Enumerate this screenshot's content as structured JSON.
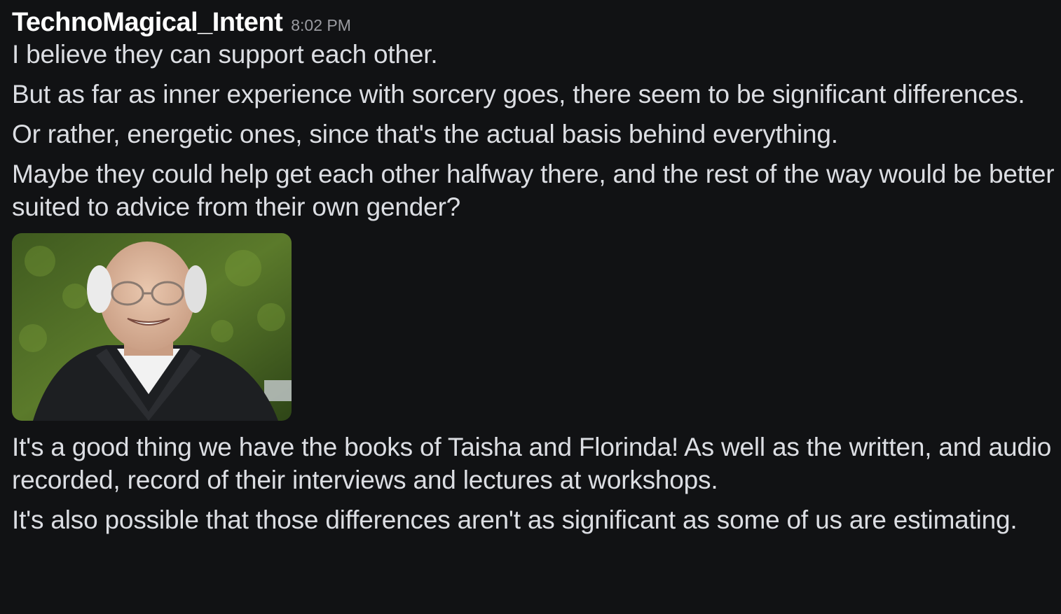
{
  "message": {
    "author": "TechnoMagical_Intent",
    "time": "8:02 PM",
    "lines_before_image": [
      "I believe they can support each other.",
      "But as far as inner experience with sorcery goes, there seem to be significant differences.",
      "Or rather, energetic ones, since that's the actual basis behind everything.",
      "Maybe they could help get each other halfway there, and the rest of the way would be better suited to advice from their own gender?"
    ],
    "image": {
      "icon": "reaction-gif-image"
    },
    "lines_after_image": [
      "It's a good thing we have the books of Taisha and Florinda! As well as the written, and audio recorded, record of their interviews and lectures at workshops.",
      "It's also possible that those differences aren't as significant as some of us are estimating."
    ]
  },
  "colors": {
    "background": "#111214",
    "username": "#ffffff",
    "text": "#dcdee3",
    "timestamp": "#9a9ba1"
  }
}
